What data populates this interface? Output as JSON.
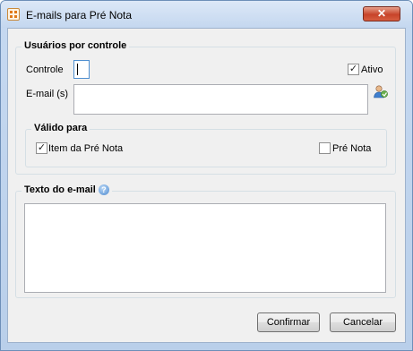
{
  "window": {
    "title": "E-mails para Pré Nota",
    "close_glyph": "✕",
    "app_icon": "app-icon"
  },
  "usuarios": {
    "group_title": "Usuários por controle",
    "controle_label": "Controle",
    "controle_value": "",
    "ativo_label": "Ativo",
    "ativo_checked": true,
    "email_label": "E-mail (s)",
    "email_value": "",
    "user_lookup_icon": "users-icon"
  },
  "valido_para": {
    "group_title": "Válido para",
    "item_label": "Item da Pré Nota",
    "item_checked": true,
    "pre_nota_label": "Pré Nota",
    "pre_nota_checked": false
  },
  "texto": {
    "group_title": "Texto do e-mail",
    "help_glyph": "?",
    "body_value": ""
  },
  "buttons": {
    "confirmar_label": "Confirmar",
    "cancelar_label": "Cancelar"
  },
  "colors": {
    "titlebar": "#c4d7ef",
    "close": "#c7442a",
    "client_bg": "#f0f0f0"
  }
}
